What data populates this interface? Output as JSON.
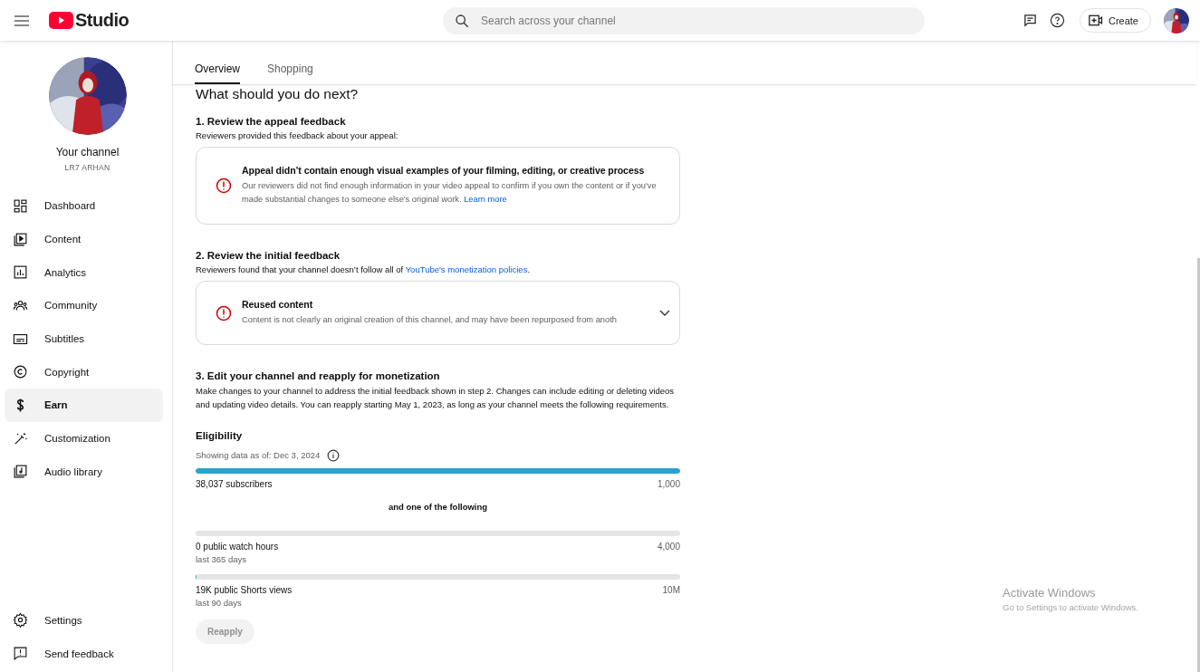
{
  "header": {
    "logo_text": "Studio",
    "search": {
      "placeholder": "Search across your channel"
    },
    "create_button": "Create"
  },
  "channel": {
    "title": "Your channel",
    "name": "LR7 ARHAN"
  },
  "sidebar": {
    "items": [
      {
        "kind": "dashboard",
        "label": "Dashboard",
        "selected": false
      },
      {
        "kind": "content",
        "label": "Content",
        "selected": false
      },
      {
        "kind": "analytics",
        "label": "Analytics",
        "selected": false
      },
      {
        "kind": "community",
        "label": "Community",
        "selected": false
      },
      {
        "kind": "subtitles",
        "label": "Subtitles",
        "selected": false
      },
      {
        "kind": "copyright",
        "label": "Copyright",
        "selected": false
      },
      {
        "kind": "earn",
        "label": "Earn",
        "selected": true
      },
      {
        "kind": "customization",
        "label": "Customization",
        "selected": false
      },
      {
        "kind": "audio",
        "label": "Audio library",
        "selected": false
      }
    ],
    "bottom_items": [
      {
        "kind": "settings",
        "label": "Settings"
      },
      {
        "kind": "feedback",
        "label": "Send feedback"
      }
    ]
  },
  "tabs": [
    {
      "label": "Overview",
      "selected": true
    },
    {
      "label": "Shopping",
      "selected": false
    }
  ],
  "heading": "What should you do next?",
  "step1": {
    "title": "1. Review the appeal feedback",
    "subtitle": "Reviewers provided this feedback about your appeal:",
    "card": {
      "title": "Appeal didn’t contain enough visual examples of your filming, editing, or creative process",
      "text": "Our reviewers did not find enough information in your video appeal to confirm if you own the content or if you've made substantial changes to someone else's original work.",
      "link": "Learn more"
    }
  },
  "step2": {
    "title": "2. Review the initial feedback",
    "subtitle": "Reviewers found that your channel doesn’t follow all of",
    "link": "YouTube's monetization policies",
    "subtitle_end": ".",
    "card": {
      "title": "Reused content",
      "text": "Content is not clearly an original creation of this channel, and may have been repurposed from anoth",
      "expanded": false
    }
  },
  "step3": {
    "title": "3. Edit your channel and reapply for monetization",
    "text": "Make changes to your channel to address the initial feedback shown in step 2. Changes can include editing or deleting videos and updating video details. You can reapply starting May 1, 2023, as long as your channel meets the following requirements."
  },
  "eligibility": {
    "title": "Eligibility",
    "data_note": "Showing data as of: Dec 3, 2024",
    "separator": "and one of the following",
    "metrics": [
      {
        "label": "38,037 subscribers",
        "target": "1,000",
        "level": 1
      },
      {
        "label": "0 public watch hours",
        "period": "last 365 days",
        "target": "4,000",
        "level": 0
      },
      {
        "label": "19K public Shorts views",
        "period": "last 90 days",
        "target": "10M",
        "level": 0.002
      }
    ]
  },
  "reapply_button": {
    "label": "Reapply",
    "disabled": true
  },
  "os_notice": {
    "title": "Activate Windows",
    "text": "Go to Settings to activate Windows."
  }
}
